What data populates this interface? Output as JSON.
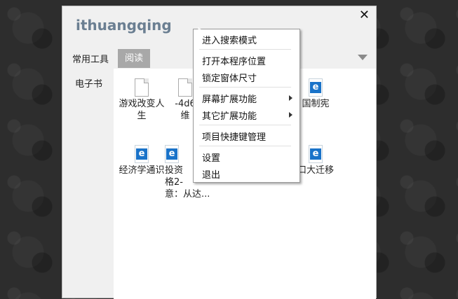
{
  "app": {
    "title": "ithuangqing",
    "close_glyph": "✕"
  },
  "tabs": {
    "common": "常用工具",
    "read": "阅读"
  },
  "sidebar": {
    "ebook": "电子书"
  },
  "items": [
    {
      "icon": "doc-icon",
      "label": "游戏改变人\n生"
    },
    {
      "icon": "doc-icon",
      "label": "-4d6\n维"
    },
    {
      "icon": "ie-icon",
      "label": "国制宪"
    },
    {
      "icon": "ie-icon",
      "label": "经济学通识"
    },
    {
      "icon": "ie-icon",
      "label": "投资\n格2-\n意：从达..."
    },
    {
      "icon": "ie-icon",
      "label": "口大迁移"
    }
  ],
  "menu": {
    "items": [
      "进入搜索模式",
      "打开本程序位置",
      "锁定窗体尺寸",
      "屏幕扩展功能",
      "其它扩展功能",
      "项目快捷键管理",
      "设置",
      "退出"
    ]
  },
  "colors": {
    "title": "#6b7f92",
    "active_tab": "#a8a8a8",
    "ie_blue": "#1a73c9"
  }
}
